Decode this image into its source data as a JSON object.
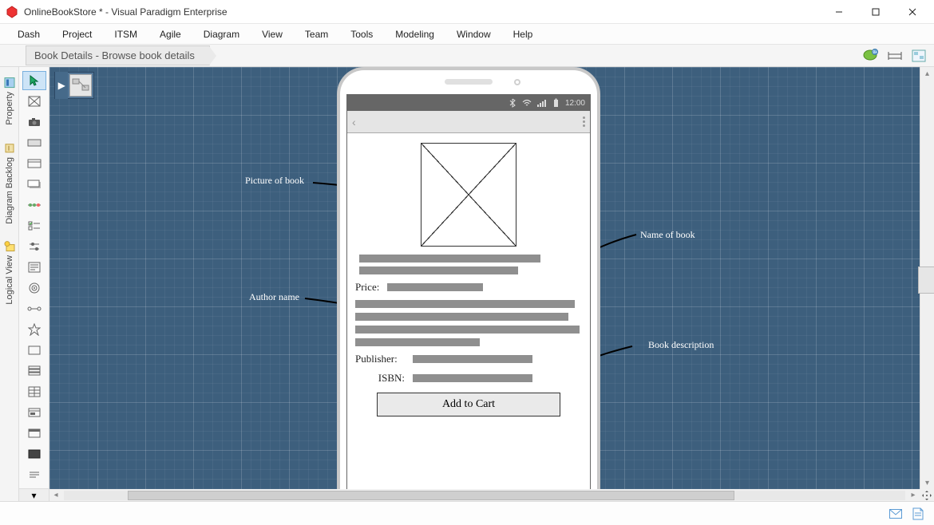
{
  "window": {
    "title": "OnlineBookStore * - Visual Paradigm Enterprise"
  },
  "menu": [
    "Dash",
    "Project",
    "ITSM",
    "Agile",
    "Diagram",
    "View",
    "Team",
    "Tools",
    "Modeling",
    "Window",
    "Help"
  ],
  "breadcrumb": {
    "item": "Book Details - Browse book details"
  },
  "left_tabs": [
    "Property",
    "Diagram Backlog",
    "Logical View"
  ],
  "palette_icons": [
    "cursor",
    "cross-rect",
    "camera",
    "frame",
    "panel",
    "panel-shadow",
    "timeline",
    "checklist",
    "sliders",
    "form",
    "target",
    "connector",
    "star",
    "rect",
    "stack-rows",
    "stack-cols",
    "grid-rect",
    "window",
    "image-frame",
    "more"
  ],
  "statusbar": {
    "time": "12:00",
    "icons": [
      "bluetooth",
      "wifi",
      "signal",
      "battery"
    ]
  },
  "wireframe": {
    "price_label": "Price:",
    "publisher_label": "Publisher:",
    "isbn_label": "ISBN:",
    "button": "Add to Cart"
  },
  "annotations": {
    "picture": "Picture of book",
    "name": "Name of book",
    "author": "Author name",
    "description": "Book description"
  }
}
